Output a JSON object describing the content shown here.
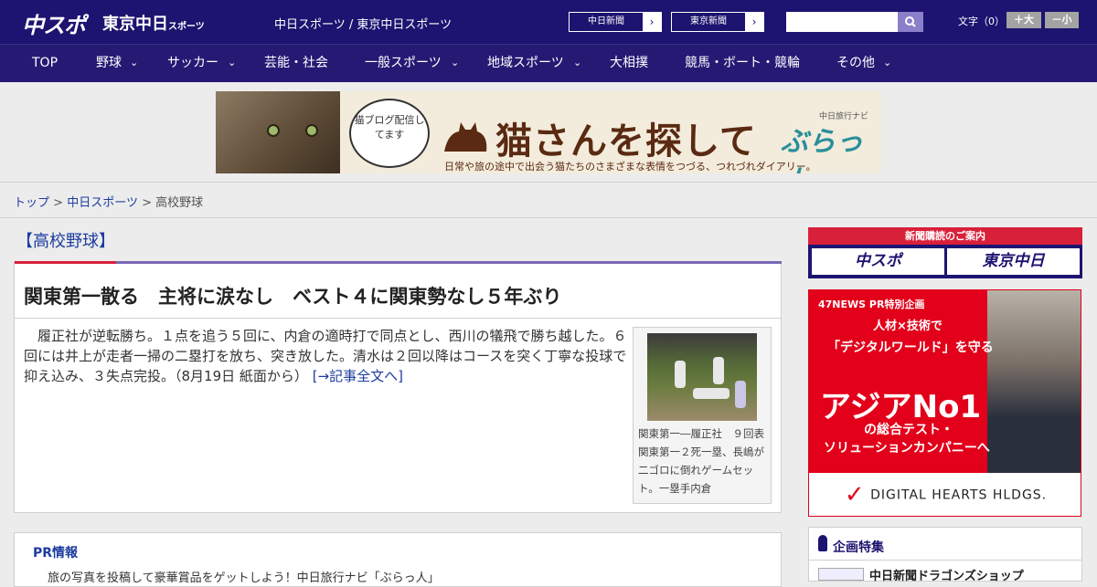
{
  "header": {
    "logo_main": "中スポ",
    "logo_tokyo": "東京中日",
    "logo_tokyo_suffix": "スポーツ",
    "site_links": "中日スポーツ / 東京中日スポーツ",
    "paper_chunichi": "中日新聞",
    "paper_tokyo": "東京新聞",
    "arrow": "›",
    "search_placeholder": "",
    "font_label": "文字（0）",
    "font_large": "＋大",
    "font_small": "－小"
  },
  "nav": {
    "items": [
      "TOP",
      "野球",
      "サッカー",
      "芸能・社会",
      "一般スポーツ",
      "地域スポーツ",
      "大相撲",
      "競馬・ボート・競輪",
      "その他"
    ],
    "chevron": "⌄"
  },
  "banner": {
    "bubble_text": "猫ブログ配信してます",
    "title": "猫さんを探して",
    "subtitle": "日常や旅の途中で出会う猫たちのさまざまな表情をつづる、つれづれダイアリー。",
    "brand_small": "中日旅行ナビ",
    "brand": "ぶらっ人"
  },
  "breadcrumb": {
    "home": "トップ",
    "sep": ">",
    "section": "中日スポーツ",
    "current": "高校野球"
  },
  "section_title": "【高校野球】",
  "article": {
    "headline": "関東第一散る　主将に涙なし　ベスト４に関東勢なし５年ぶり",
    "body": "履正社が逆転勝ち。１点を追う５回に、内倉の適時打で同点とし、西川の犠飛で勝ち越した。６回には井上が走者一掃の二塁打を放ち、突き放した。清水は２回以降はコースを突く丁寧な投球で抑え込み、３失点完投。（8月19日 紙面から）",
    "more_link": "[→記事全文へ]",
    "photo_caption": "関東第一―履正社　９回表関東第一２死一塁、長嶋が二ゴロに倒れゲームセット。一塁手内倉"
  },
  "pr": {
    "title": "PR情報",
    "text": "旅の写真を投稿して豪華賞品をゲットしよう！中日旅行ナビ「ぶらっ人」"
  },
  "sidebar": {
    "subscribe_title": "新聞購読のご案内",
    "subscribe_chuspo": "中スポ",
    "subscribe_tokyo": "東京中日",
    "ad_head": "47NEWS PR特別企画",
    "ad_line1": "人材×技術で",
    "ad_line2": "「デジタルワールド」を守る",
    "ad_big": "アジアNo1",
    "ad_line3": "の総合テスト・",
    "ad_line4": "ソリューションカンパニーへ",
    "ad_foot": "DIGITAL HEARTS HLDGS.",
    "feature_title": "企画特集",
    "feature_item": "中日新聞ドラゴンズショップ"
  }
}
